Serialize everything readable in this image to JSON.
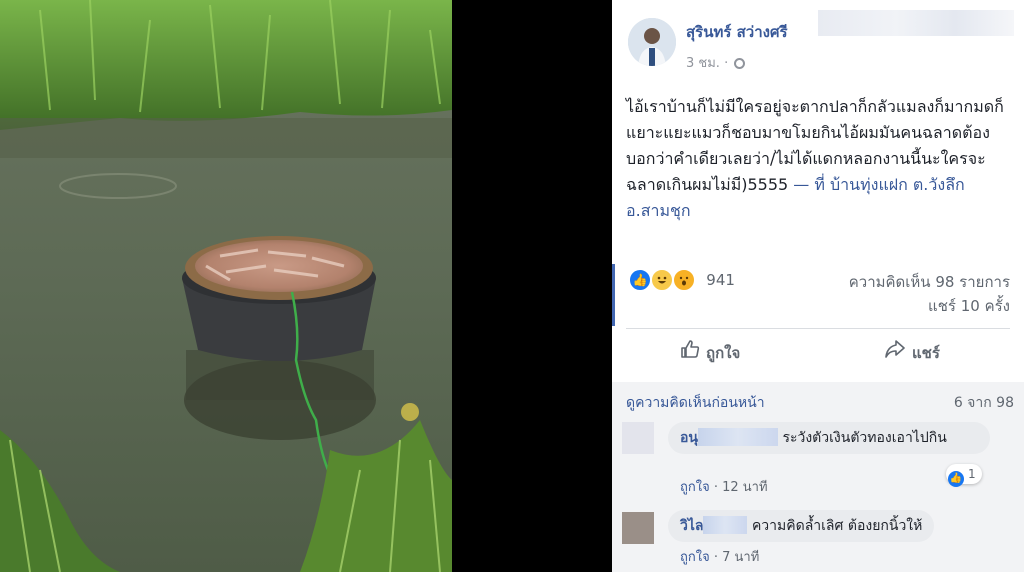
{
  "post": {
    "author": "สุรินทร์ สว่างศรี",
    "time": "3 ชม.",
    "text": "ไอ้เราบ้านก็ไม่มีใครอยู่จะตากปลาก็กลัวแมลงก็มากมดก็แยาะแยะแมวก็ชอบมาขโมยกินไอ้ผมมันคนฉลาดต้องบอกว่าคำเดียวเลยว่า/ไม่ได้แดกหลอกงานนี้นะใครจะฉลาดเกินผมไม่มี)5555",
    "location_prefix": " — ที่ ",
    "location": "บ้านทุ่งแฝก ต.วังลึก อ.สามชุก"
  },
  "stats": {
    "reaction_count": "941",
    "comments": "ความคิดเห็น 98 รายการ",
    "shares": "แชร์ 10 ครั้ง"
  },
  "actions": {
    "like": "ถูกใจ",
    "share": "แชร์"
  },
  "comments_header": {
    "prev_link": "ดูความคิดเห็นก่อนหน้า",
    "page_count": "6 จาก 98"
  },
  "comments": [
    {
      "name": "อนุ",
      "text": "ระวังตัวเงินตัวทองเอาไปกิน",
      "like_label": "ถูกใจ",
      "time": "12 นาที",
      "reaction_count": "1"
    },
    {
      "name": "วิไล",
      "text": "ความคิดล้ำเลิศ ต้องยกนิ้วให้",
      "like_label": "ถูกใจ",
      "time": "7 นาที"
    }
  ],
  "icons": {
    "privacy": "globe-icon",
    "like": "thumbs-up-icon",
    "share": "share-arrow-icon"
  },
  "colors": {
    "link": "#385898",
    "like_blue": "#1877f2",
    "text": "#1d2129",
    "muted": "#606770"
  }
}
